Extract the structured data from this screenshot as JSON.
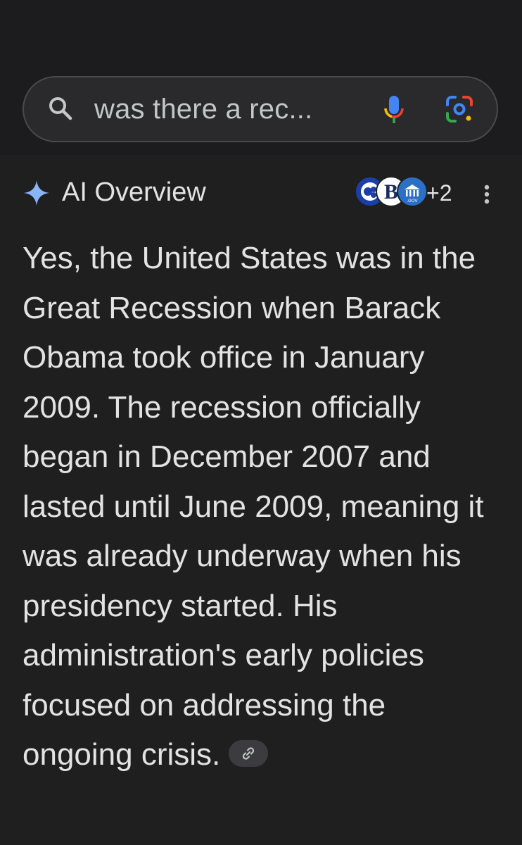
{
  "search": {
    "query": "was there a rec..."
  },
  "overview": {
    "title": "AI Overview",
    "source_more_count": "+2",
    "source_badge_text": "B",
    "source_badge_small": ".GOV",
    "answer": "Yes, the United States was in the Great Recession when Barack Obama took office in January 2009. The recession officially began in December 2007 and lasted until June 2009, meaning it was already underway when his presidency started. His administration's early policies focused on addressing the ongoing crisis."
  },
  "icons": {
    "search": "search-icon",
    "mic": "mic-icon",
    "lens": "lens-icon",
    "sparkle": "sparkle-icon",
    "more": "more-vert-icon",
    "link": "link-icon"
  },
  "colors": {
    "background": "#1f1f1f",
    "text": "#e3e3e3",
    "sparkle": "#8ab4f8",
    "google_blue": "#4285f4",
    "google_red": "#ea4335",
    "google_yellow": "#fbbc04",
    "google_green": "#34a853"
  }
}
